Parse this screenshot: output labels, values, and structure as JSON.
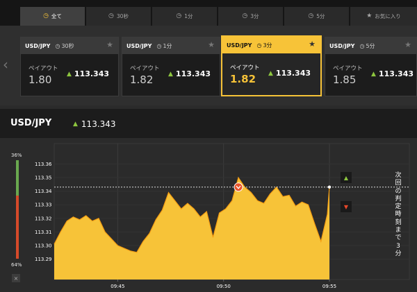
{
  "tabs": [
    {
      "label": "全て",
      "icon": "clock-icon",
      "active": true
    },
    {
      "label": "30秒",
      "icon": "clock-icon",
      "active": false
    },
    {
      "label": "1分",
      "icon": "clock-icon",
      "active": false
    },
    {
      "label": "3分",
      "icon": "clock-icon",
      "active": false
    },
    {
      "label": "5分",
      "icon": "clock-icon",
      "active": false
    },
    {
      "label": "お気に入り",
      "icon": "star-icon",
      "active": false
    }
  ],
  "cards": [
    {
      "pair": "USD/JPY",
      "time": "30秒",
      "payout_label": "ペイアウト",
      "payout": "1.80",
      "rate": "113.343",
      "active": false
    },
    {
      "pair": "USD/JPY",
      "time": "1分",
      "payout_label": "ペイアウト",
      "payout": "1.82",
      "rate": "113.343",
      "active": false
    },
    {
      "pair": "USD/JPY",
      "time": "3分",
      "payout_label": "ペイアウト",
      "payout": "1.82",
      "rate": "113.343",
      "active": true
    },
    {
      "pair": "USD/JPY",
      "time": "5分",
      "payout_label": "ペイアウト",
      "payout": "1.85",
      "rate": "113.343",
      "active": false
    }
  ],
  "header": {
    "pair": "USD/JPY",
    "rate": "113.343"
  },
  "ratio": {
    "high_label": "36%",
    "low_label": "64%",
    "high": 0.36,
    "low": 0.64,
    "close": "×"
  },
  "vertical_text": "次回の判定時刻まで3分",
  "colors": {
    "accent": "#f7c338",
    "up": "#8dc63f",
    "down": "#e8472a",
    "line": "#f39c12"
  },
  "chart_data": {
    "type": "area",
    "ylim": [
      113.275,
      113.375
    ],
    "yticks": [
      "113.36",
      "113.35",
      "113.34",
      "113.33",
      "113.32",
      "113.31",
      "113.30",
      "113.29"
    ],
    "xticks": [
      "09:45",
      "09:50",
      "09:55"
    ],
    "current_price": 113.343,
    "entry_marker": {
      "x": 50.7,
      "y": 113.343
    },
    "x": [
      42.0,
      42.3,
      42.6,
      42.9,
      43.2,
      43.5,
      43.8,
      44.1,
      44.4,
      44.7,
      45.0,
      45.3,
      45.6,
      45.9,
      46.2,
      46.5,
      46.8,
      47.1,
      47.4,
      47.7,
      48.0,
      48.3,
      48.6,
      48.9,
      49.2,
      49.5,
      49.8,
      50.1,
      50.4,
      50.7,
      51.0,
      51.3,
      51.6,
      51.9,
      52.2,
      52.5,
      52.8,
      53.1,
      53.4,
      53.7,
      54.0,
      54.3,
      54.6,
      54.9,
      55.0
    ],
    "values": [
      113.301,
      113.31,
      113.318,
      113.321,
      113.319,
      113.322,
      113.318,
      113.32,
      113.31,
      113.305,
      113.3,
      113.298,
      113.296,
      113.295,
      113.303,
      113.309,
      113.319,
      113.326,
      113.339,
      113.333,
      113.327,
      113.331,
      113.327,
      113.321,
      113.325,
      113.306,
      113.324,
      113.327,
      113.333,
      113.35,
      113.343,
      113.339,
      113.333,
      113.331,
      113.338,
      113.343,
      113.336,
      113.337,
      113.329,
      113.332,
      113.33,
      113.316,
      113.303,
      113.323,
      113.343
    ]
  }
}
